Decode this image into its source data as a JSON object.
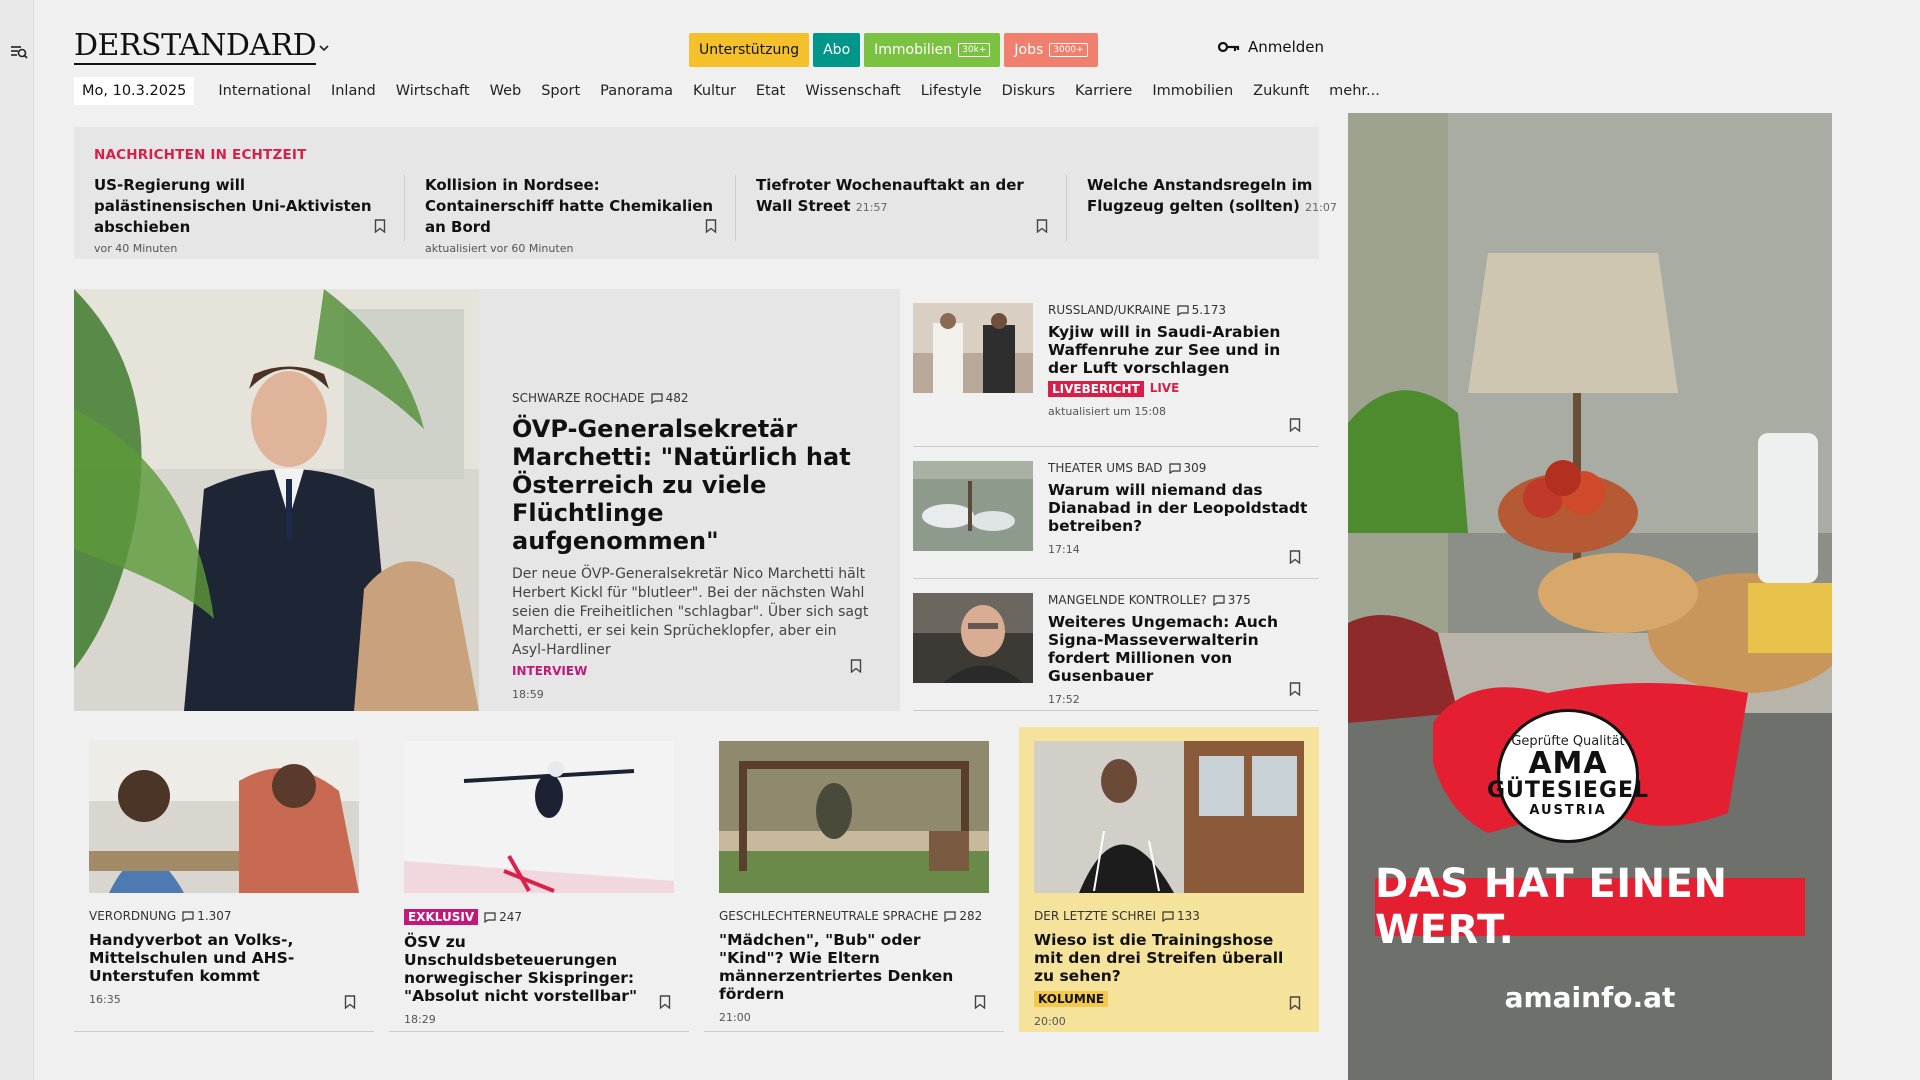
{
  "header": {
    "logo": "DERSTANDARD",
    "buttons": [
      {
        "label": "Unterstützung",
        "bg": "#f5c12b",
        "color": "#111"
      },
      {
        "label": "Abo",
        "bg": "#00968a",
        "color": "#fff"
      },
      {
        "label": "Immobilien",
        "badge": "30k+",
        "bg": "#7cc242",
        "color": "#fff"
      },
      {
        "label": "Jobs",
        "badge": "3000+",
        "bg": "#f07f6e",
        "color": "#fff"
      }
    ],
    "login": "Anmelden"
  },
  "nav": {
    "date": "Mo, 10.3.2025",
    "items": [
      "International",
      "Inland",
      "Wirtschaft",
      "Web",
      "Sport",
      "Panorama",
      "Kultur",
      "Etat",
      "Wissenschaft",
      "Lifestyle",
      "Diskurs",
      "Karriere",
      "Immobilien",
      "Zukunft",
      "mehr..."
    ]
  },
  "ticker": {
    "title": "NACHRICHTEN IN ECHTZEIT",
    "items": [
      {
        "headline": "US-Regierung will palästinensischen Uni-Aktivisten abschieben",
        "time": "",
        "meta": "vor 40 Minuten"
      },
      {
        "headline": "Kollision in Nordsee: Containerschiff hatte Chemikalien an Bord",
        "time": "",
        "meta": "aktualisiert vor 60 Minuten"
      },
      {
        "headline": "Tiefroter Wochenauftakt an der Wall Street",
        "time": "21:57",
        "meta": ""
      },
      {
        "headline": "Welche Anstandsregeln im Flugzeug gelten (sollten)",
        "time": "21:07",
        "meta": ""
      }
    ]
  },
  "hero": {
    "kicker": "SCHWARZE ROCHADE",
    "comments": "482",
    "title": "ÖVP-Generalsekretär Marchetti: \"Natürlich hat Österreich zu viele Flüchtlinge aufgenommen\"",
    "teaser": "Der neue ÖVP-Generalsekretär Nico Marchetti hält Herbert Kickl für \"blutleer\". Bei der nächsten Wahl seien die Freiheitlichen \"schlagbar\". Über sich sagt Marchetti, er sei kein Sprücheklopfer, aber ein Asyl-Hardliner",
    "tag": "INTERVIEW",
    "time": "18:59"
  },
  "side": [
    {
      "kicker": "RUSSLAND/UKRAINE",
      "comments": "5.173",
      "title": "Kyjiw will in Saudi-Arabien Waffenruhe zur See und in der Luft vorschlagen",
      "live_badge": "LIVEBERICHT",
      "live_word": "LIVE",
      "time": "aktualisiert um 15:08"
    },
    {
      "kicker": "THEATER UMS BAD",
      "comments": "309",
      "title": "Warum will niemand das Dianabad in der Leopoldstadt betreiben?",
      "time": "17:14"
    },
    {
      "kicker": "MANGELNDE KONTROLLE?",
      "comments": "375",
      "title": "Weiteres Ungemach: Auch Signa-Masseverwalterin fordert Millionen von Gusenbauer",
      "time": "17:52"
    }
  ],
  "grid": [
    {
      "kicker": "VERORDNUNG",
      "comments": "1.307",
      "title": "Handyverbot an Volks-, Mittelschulen und AHS-Unterstufen kommt",
      "time": "16:35"
    },
    {
      "excl": "EXKLUSIV",
      "comments": "247",
      "title": "ÖSV zu Unschuldsbeteuerungen norwegischer Skispringer: \"Absolut nicht vorstellbar\"",
      "time": "18:29"
    },
    {
      "kicker": "GESCHLECHTERNEUTRALE SPRACHE",
      "comments": "282",
      "title": "\"Mädchen\", \"Bub\" oder \"Kind\"? Wie Eltern männerzentriertes Denken fördern",
      "time": "21:00"
    },
    {
      "kicker": "DER LETZTE SCHREI",
      "comments": "133",
      "title": "Wieso ist die Trainingshose mit den drei Streifen überall zu sehen?",
      "tag": "KOLUMNE",
      "time": "20:00"
    }
  ],
  "ad": {
    "seal_top": "Geprüfte Qualität",
    "seal_main": "AMA",
    "seal_sub": "GÜTESIEGEL",
    "seal_country": "AUSTRIA",
    "banner": "DAS HAT EINEN WERT.",
    "url": "amainfo.at"
  },
  "colors": {
    "accent_red": "#d6204a",
    "accent_pink": "#c0197a",
    "kolumne_yellow": "#f5e29b"
  }
}
